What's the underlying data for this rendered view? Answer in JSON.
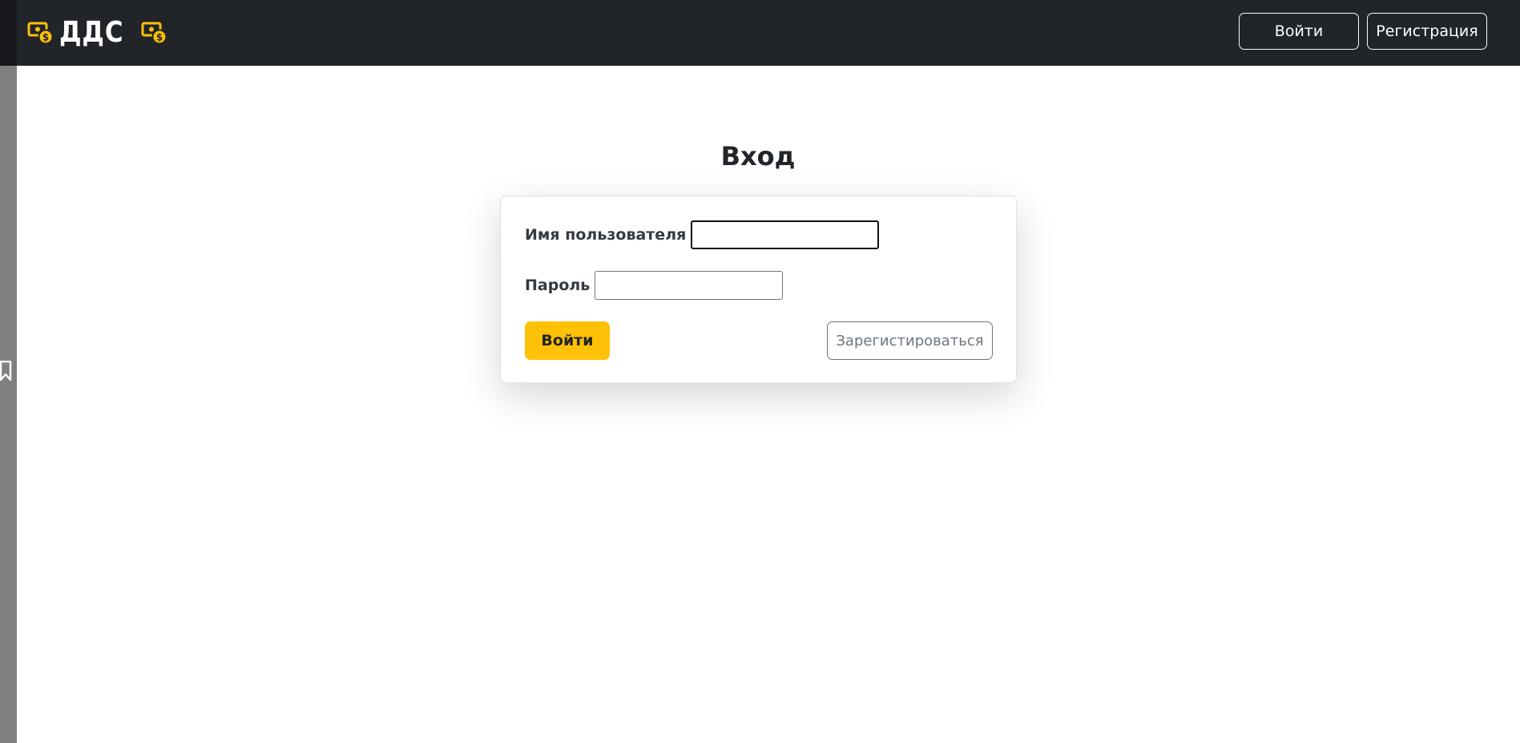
{
  "brand": {
    "name": "ДДС",
    "accent_color": "#ffc107",
    "icon": "money-bill-icon"
  },
  "navbar": {
    "login_label": "Войти",
    "register_label": "Регистрация",
    "background_color": "#212529"
  },
  "page": {
    "title": "Вход"
  },
  "form": {
    "username_label": "Имя пользователя",
    "username_value": "",
    "password_label": "Пароль",
    "password_value": "",
    "submit_label": "Войти",
    "submit_color": "#ffc107",
    "register_label": "Зарегистироваться"
  },
  "sidebar_strip": {
    "icon": "bookmark-icon"
  }
}
